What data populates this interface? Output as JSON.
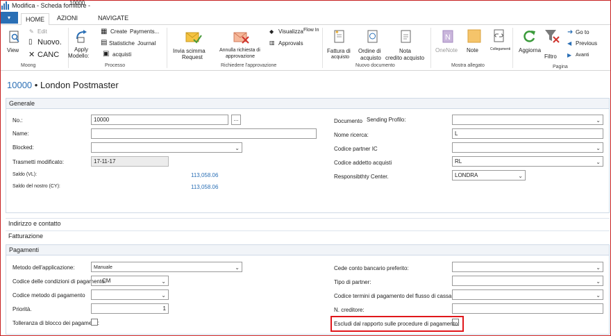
{
  "window": {
    "title": "Modifica - Scheda fornitore -",
    "title_overlap": "10000"
  },
  "ribbon": {
    "tabs": [
      "HOME",
      "AZIONI",
      "NAVIGATE"
    ],
    "moong": {
      "view": "View",
      "edit": "Edit",
      "nuovo": "Nuovo.",
      "canc": "CANC",
      "label": "Moong"
    },
    "processo": {
      "apply": "Apply",
      "modello": "Modello:",
      "create": "Create",
      "payments": "Payments...",
      "statistiche": "Statistiche",
      "journal": "Journal",
      "acquisti": "acquisti",
      "label": "Processo"
    },
    "approvazione": {
      "invia": "Invia scimma",
      "request": "Request",
      "annulla": "Annulla richiesta di",
      "approvazione_txt": "approvazione",
      "visualizza": "Visualizza",
      "flowin": "Flow In",
      "approvals": "Approvals",
      "label": "Richiedere l'approvazione"
    },
    "nuovo_doc": {
      "fattura": "Fattura di",
      "acquisto": "acquisto",
      "ordine": "Ordine di",
      "acquisto2": "acquisto",
      "nota": "Nota",
      "credito": "credito acquisto",
      "label": "Nuovo documento"
    },
    "allegato": {
      "onenote": "OneNote",
      "note": "Note",
      "collegamenti": "Collegamenti",
      "label": "Mostra allegato"
    },
    "pagina": {
      "aggiorna": "Aggiorna",
      "filtro": "Filtro",
      "goto": "Go to",
      "previous": "Previous",
      "avanti": "Avanti",
      "label": "Pagina"
    }
  },
  "heading": {
    "no": "10000",
    "sep": " • ",
    "name": "London Postmaster"
  },
  "sections": {
    "generale": "Generale",
    "indirizzo": "Indirizzo e contatto",
    "fatturazione": "Fatturazione",
    "pagamenti": "Pagamenti"
  },
  "generale": {
    "no_label": "No.:",
    "no_value": "10000",
    "name_label": "Name:",
    "blocked_label": "Blocked:",
    "trasmetti_label": "Trasmetti modificato:",
    "trasmetti_value": "17-11-17",
    "saldo_label": "Saldo (VL):",
    "saldo_value": "113,058.06",
    "saldo_nostro_label": "Saldo del nostro (CY):",
    "saldo_nostro_value": "113,058.06",
    "document_label": "Documento",
    "sending_label": "Sending Profilo:",
    "nome_ricerca_label": "Nome ricerca:",
    "nome_ricerca_value": "L",
    "codice_partner_label": "Codice partner IC",
    "codice_addetto_label": "Codice addetto acquisti",
    "codice_addetto_value": "RL",
    "resp_label": "Responsibthty Center.",
    "resp_value": "LONDRA"
  },
  "pagamenti": {
    "metodo_label": "Metodo dell'applicazione:",
    "metodo_value": "Manuale",
    "codice_cond_label": "Codice delle condizioni di pagamento:",
    "codice_cond_value": "CM",
    "codice_metodo_label": "Codice metodo di pagamento",
    "priorita_label": "Priorità.",
    "priorita_value": "1",
    "tolleranza_label": "Tolleranza di blocco dei pagamenti:",
    "cede_label": "Cede conto bancario preferito:",
    "tipo_partner_label": "Tipo di partner:",
    "codice_termini_label": "Codice termini di pagamento del flusso di cassa",
    "n_creditore_label": "N. creditore:",
    "escludi_label": "Escludi dal rapporto sulle procedure di pagamento:"
  }
}
